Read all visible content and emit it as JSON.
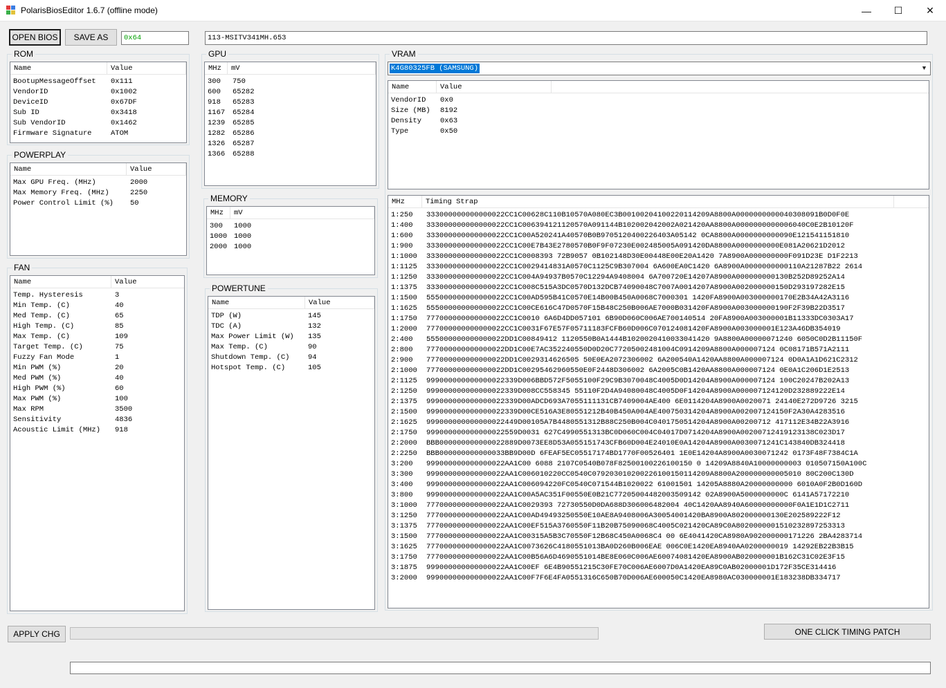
{
  "window": {
    "title": "PolarisBiosEditor 1.6.7 (offline mode)",
    "minimize": "—",
    "maximize": "☐",
    "close": "✕"
  },
  "toolbar": {
    "open_bios": "OPEN BIOS",
    "save_as": "SAVE AS",
    "checksum": "0x64",
    "part_number": "113-MSITV341MH.653"
  },
  "rom": {
    "label": "ROM",
    "columns": [
      "Name",
      "Value"
    ],
    "rows": [
      [
        "BootupMessageOffset",
        "0x111"
      ],
      [
        "VendorID",
        "0x1002"
      ],
      [
        "DeviceID",
        "0x67DF"
      ],
      [
        "Sub ID",
        "0x3418"
      ],
      [
        "Sub VendorID",
        "0x1462"
      ],
      [
        "Firmware Signature",
        "ATOM"
      ]
    ]
  },
  "powerplay": {
    "label": "POWERPLAY",
    "columns": [
      "Name",
      "Value"
    ],
    "rows": [
      [
        "Max GPU Freq. (MHz)",
        "2000"
      ],
      [
        "Max Memory Freq. (MHz)",
        "2250"
      ],
      [
        "Power Control Limit (%)",
        "50"
      ]
    ]
  },
  "fan": {
    "label": "FAN",
    "columns": [
      "Name",
      "Value"
    ],
    "rows": [
      [
        "Temp. Hysteresis",
        "3"
      ],
      [
        "Min Temp. (C)",
        "40"
      ],
      [
        "Med Temp. (C)",
        "65"
      ],
      [
        "High Temp. (C)",
        "85"
      ],
      [
        "Max Temp. (C)",
        "109"
      ],
      [
        "Target Temp. (C)",
        "75"
      ],
      [
        "Fuzzy Fan Mode",
        "1"
      ],
      [
        "Min PWM (%)",
        "20"
      ],
      [
        "Med PWM (%)",
        "40"
      ],
      [
        "High PWM (%)",
        "60"
      ],
      [
        "Max PWM (%)",
        "100"
      ],
      [
        "Max RPM",
        "3500"
      ],
      [
        "Sensitivity",
        "4836"
      ],
      [
        "Acoustic Limit (MHz)",
        "918"
      ]
    ]
  },
  "gpu": {
    "label": "GPU",
    "columns": [
      "MHz",
      "mV"
    ],
    "rows": [
      [
        "300",
        "750"
      ],
      [
        "600",
        "65282"
      ],
      [
        "918",
        "65283"
      ],
      [
        "1167",
        "65284"
      ],
      [
        "1239",
        "65285"
      ],
      [
        "1282",
        "65286"
      ],
      [
        "1326",
        "65287"
      ],
      [
        "1366",
        "65288"
      ]
    ]
  },
  "memory": {
    "label": "MEMORY",
    "columns": [
      "MHz",
      "mV"
    ],
    "rows": [
      [
        "300",
        "1000"
      ],
      [
        "1000",
        "1000"
      ],
      [
        "2000",
        "1000"
      ]
    ]
  },
  "powertune": {
    "label": "POWERTUNE",
    "columns": [
      "Name",
      "Value"
    ],
    "rows": [
      [
        "TDP (W)",
        "145"
      ],
      [
        "TDC (A)",
        "132"
      ],
      [
        "Max Power Limit (W)",
        "135"
      ],
      [
        "Max Temp. (C)",
        "90"
      ],
      [
        "Shutdown Temp. (C)",
        "94"
      ],
      [
        "Hotspot Temp. (C)",
        "105"
      ]
    ]
  },
  "vram": {
    "label": "VRAM",
    "selected": "K4G80325FB (SAMSUNG)",
    "info_columns": [
      "Name",
      "Value"
    ],
    "info_rows": [
      [
        "VendorID",
        "0x0"
      ],
      [
        "Size (MB)",
        "8192"
      ],
      [
        "Density",
        "0x63"
      ],
      [
        "Type",
        "0x50"
      ]
    ],
    "timing_columns": [
      "MHz",
      "Timing Strap"
    ],
    "timing_rows": [
      [
        "1:250",
        "333000000000000022CC1C00628C110B10570A080EC3B00100204100220114209A8800A0000000000040308091B0D0F0E"
      ],
      [
        "1:400",
        "333000000000000022CC1C006394121120570A091144B102002042002A021420AA8800A0000000000006040C0E2B10120F"
      ],
      [
        "1:600",
        "333000000000000022CC1C00A520241A40570B0B9705120400226403A05142 0CA8800A0000000000090E121541151810"
      ],
      [
        "1:900",
        "333000000000000022CC1C00E7B43E2780570B0F9F07230E002485005A091420DA8800A0000000000E081A20621D2012"
      ],
      [
        "1:1000",
        "333000000000000022CC1C0008393 72B9057 0B102148D30E00448E00E20A1420 7A8900A000000000F091D23E D1F2213"
      ],
      [
        "1:1125",
        "333000000000000022CC1C0029414831A0570C1125C9B307004 6A600EA0C1420 6A8900A0000000000110A21287B22 2614"
      ],
      [
        "1:1250",
        "333000000000000022CC1C004A94937B0570C12294A9408004 6A700720E14207A8900A000000000130B252D89252A14"
      ],
      [
        "1:1375",
        "333000000000000022CC1C008C515A3DC0570D132DCB74090048C7007A0014207A8900A002000000150D293197282E15"
      ],
      [
        "1:1500",
        "555000000000000022CC1C00AD595B41C0570E14B00B450A0068C7000301 1420FA8900A003000000170E2B34A42A3116"
      ],
      [
        "1:1625",
        "555000000000000022CC1C00CE616C47D0570F15B48C250B006AE7000B031420FA8900A003000000190F2F39B22D3517"
      ],
      [
        "1:1750",
        "777000000000000022CC1C0010 6A6D4DD057101 6B90D060C006AE700140514 20FA8900A003000001B11333DC0303A17"
      ],
      [
        "1:2000",
        "777000000000000022CC1C0031F67E57F05711183FCFB60D006C070124081420FA8900A003000001E123A46DB354019"
      ],
      [
        "2:400",
        "555000000000000022DD1C00849412 1120550B0A1444B1020020410033041420 9A8800A00000071240 6050C0D2B11150F"
      ],
      [
        "2:800",
        "777000000000000022DD1C00E7AC352240550D0D20C77205002481004C0914209A8800A000007124 0C08171B571A2111"
      ],
      [
        "2:900",
        "777000000000000022DD1C0029314626505 50E0EA2072306002 6A200540A1420AA8800A000007124 0D0A1A1D621C2312"
      ],
      [
        "2:1000",
        "777000000000000022DD1C00295462960550E0F2448D306002 6A2005C0B1420AA8800A000007124 0E0A1C206D1E2513"
      ],
      [
        "2:1125",
        "999000000000000022339D006BBD572F5055100F29C9B3070048C4005D0D14204A8900A000007124 100C20247B202A13"
      ],
      [
        "2:1250",
        "999000000000000022339D008CC558345 55110F2D4A94080048C4005D0F14204A8900A000007124120D232889222E14"
      ],
      [
        "2:1375",
        "999000000000000022339D00ADCD693A7055111131CB7409004AE400 6E0114204A8900A0020071 24140E272D9726 3215"
      ],
      [
        "2:1500",
        "999000000000000022339D00CE516A3E80551212B40B450A004AE400750314204A8900A002007124150F2A30A4283516"
      ],
      [
        "2:1625",
        "999000000000000022449D00105A7B4480551312B88C250B004C0401750514204A8900A00200712 417112E34B22A3916"
      ],
      [
        "2:1750",
        "999000000000000022559D0031 627C4990551313BC0D060C004C04017D0714204A8900A00200712419123138C023D17"
      ],
      [
        "2:2000",
        "BBB000000000000022889D0073EE8D53A055151743CFB60D004E24010E0A14204A8900A0030071241C143840DB324418"
      ],
      [
        "2:2250",
        "BBB000000000000033BB9D00D 6FEAF5EC05517174BD1770F00526401 1E0E14204A8900A0030071242 0173F48F7384C1A"
      ],
      [
        "3:200",
        "999000000000000022AA1C00 6088 2107C0540B078F82500100226100150 0 14209A8840A10000000003 010507150A100C"
      ],
      [
        "3:300",
        "999000000000000022AA1C006010220CC0540C079203010200226100150114209A8800A200000000005010 80C200C130D"
      ],
      [
        "3:400",
        "999000000000000022AA1C006094220FC0540C071544B1020022 61001501 14205A8880A20000000000 6010A0F2B0D160D"
      ],
      [
        "3:800",
        "999000000000000022AA1C00A5AC351F00550E0B21C77205004482003509142 02A8900A5000000000C 6141A57172210"
      ],
      [
        "3:1000",
        "777000000000000022AA1C0029393 72730550D0DA688D306006482004 40C1420AA8940A60000000000F0A1E1D1C2711"
      ],
      [
        "3:1250",
        "777000000000000022AA1C00AD49493250550E10AE8A9408006A30054001420BA8900A802000000130E202589222F12"
      ],
      [
        "3:1375",
        "777000000000000022AA1C00EF515A3760550F11B20B75090068C4005C021420CA89C0A8020000001510232897253313"
      ],
      [
        "3:1500",
        "777000000000000022AA1C00315A5B3C70550F12B68C450A0068C4 00 6E4041420CA8980A902000000171226 2BA4283714"
      ],
      [
        "3:1625",
        "777000000000000022AA1C0073626C4180551013BA0D260B006EAE 006C0E1420EA8940AA0200000019 14292EB22B3B15"
      ],
      [
        "3:1750",
        "777000000000000022AA1C00B56A6D4690551014BE8E060C006AE60074081420EA8900AB020000001B162C31C02E3F15"
      ],
      [
        "3:1875",
        "999000000000000022AA1C00EF 6E4B90551215C30FE70C006AE6007D0A1420EA89C0AB02000001D172F35CE314416"
      ],
      [
        "3:2000",
        "999000000000000022AA1C00F7F6E4FA0551316C650B70D006AE600050C1420EA8980AC030000001E183238DB334717"
      ]
    ]
  },
  "bottom": {
    "apply_chg": "APPLY CHG",
    "one_click": "ONE CLICK TIMING PATCH",
    "status_text": ""
  },
  "colors": {
    "accent": "#0078d7",
    "checksum_green": "#00a000"
  }
}
